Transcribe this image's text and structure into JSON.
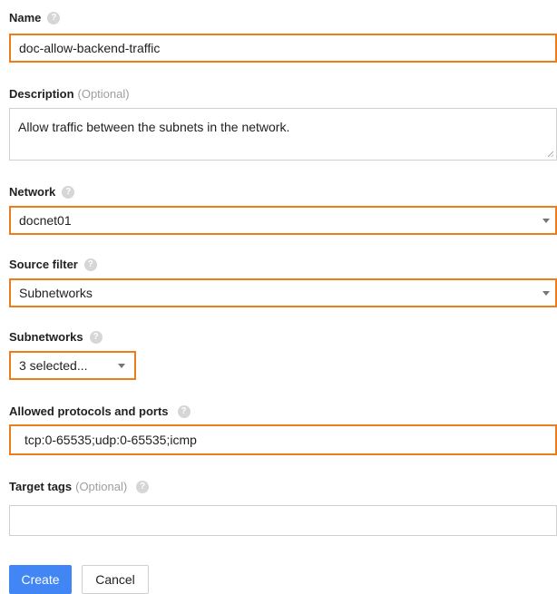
{
  "form": {
    "name": {
      "label": "Name",
      "value": "doc-allow-backend-traffic"
    },
    "description": {
      "label": "Description",
      "optional": "(Optional)",
      "value": "Allow traffic between the subnets in the network."
    },
    "network": {
      "label": "Network",
      "value": "docnet01"
    },
    "source_filter": {
      "label": "Source filter",
      "value": "Subnetworks"
    },
    "subnetworks": {
      "label": "Subnetworks",
      "value": "3 selected..."
    },
    "allowed_protocols": {
      "label": "Allowed protocols and ports",
      "value": "tcp:0-65535;udp:0-65535;icmp"
    },
    "target_tags": {
      "label": "Target tags",
      "optional": "(Optional)",
      "value": ""
    }
  },
  "buttons": {
    "create": "Create",
    "cancel": "Cancel"
  },
  "icons": {
    "help": "help-icon",
    "dropdown": "dropdown-arrow-icon",
    "resize": "resize-handle-icon"
  },
  "colors": {
    "highlight_border": "#ef7c1a",
    "primary_button": "#4285f4",
    "help_icon": "#d6d6d6"
  }
}
